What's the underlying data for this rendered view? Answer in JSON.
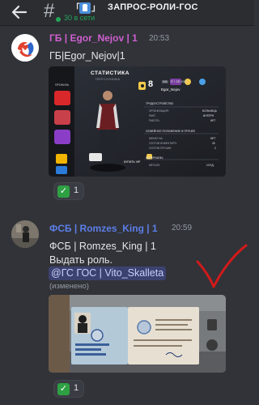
{
  "header": {
    "back_icon": "arrow-left-icon",
    "channel_icon": "hash-icon",
    "channel_emoji_left": "「",
    "channel_emoji_right": "」",
    "channel_name": "ЗАПРОС-РОЛИ-ГОС",
    "online": "30 в сети"
  },
  "colors": {
    "online": "#23a559",
    "author_gb": "#cf5fd0",
    "author_fsb": "#5d7ee8",
    "mention_bg": "#3c4270",
    "background": "#313338"
  },
  "messages": [
    {
      "author": "ГБ | Egor_Nejov | 1",
      "time": "20:53",
      "text": "ГБ|Egor_Nejov|1",
      "attachment": {
        "title": "СТАТИСТИКА",
        "subtitle": "ПЕРСОНАЖА",
        "side_menu_label": "ПРОФИЛЬ",
        "level": "8",
        "level_label": "LVL",
        "xp": "9 / 48 exp",
        "player_name": "Egor_Nejov",
        "buy_button": "КУПИТЬ VIP",
        "sections": [
          {
            "title": "ТРУДОУСТРОЙСТВО",
            "rows": [
              {
                "label": "ОРГАНИЗАЦИЯ:",
                "value": "БОЛЬНИЦА"
              },
              {
                "label": "РАНГ:",
                "value": "ИНТЕРН"
              },
              {
                "label": "РАБОТА:",
                "value": "НЕТ"
              }
            ]
          },
          {
            "title": "СЕМЕЙНОЕ ПОЛОЖЕНИЕ И ПРОЧЕЕ",
            "rows": [
              {
                "label": "ЖЕНАТ НА:",
                "value": "НЕТ"
              },
              {
                "label": "СЛОТОВ ИНВЕНТАРЯ:",
                "value": "25"
              },
              {
                "label": "СЛОТОВ ПРОЧИЕ:",
                "value": "2"
              }
            ]
          },
          {
            "title": "МАТЕРИАЛЫ",
            "rows": [
              {
                "label": "МЕТАЛЛ:",
                "value": "10 ЕД."
              }
            ]
          }
        ]
      },
      "reaction": {
        "emoji": "white-check-mark-icon",
        "count": "1"
      }
    },
    {
      "author": "ФСБ | Romzes_King | 1",
      "time": "20:59",
      "lines": [
        "ФСБ | Romzes_King | 1",
        "Выдать роль."
      ],
      "mention": "@ГС ГОС | Vito_Skalleta",
      "edited": "(изменено)",
      "reaction": {
        "emoji": "white-check-mark-icon",
        "count": "1"
      }
    }
  ],
  "annotation": {
    "color": "#d11a1a",
    "icon": "check-mark-annotation-icon"
  }
}
